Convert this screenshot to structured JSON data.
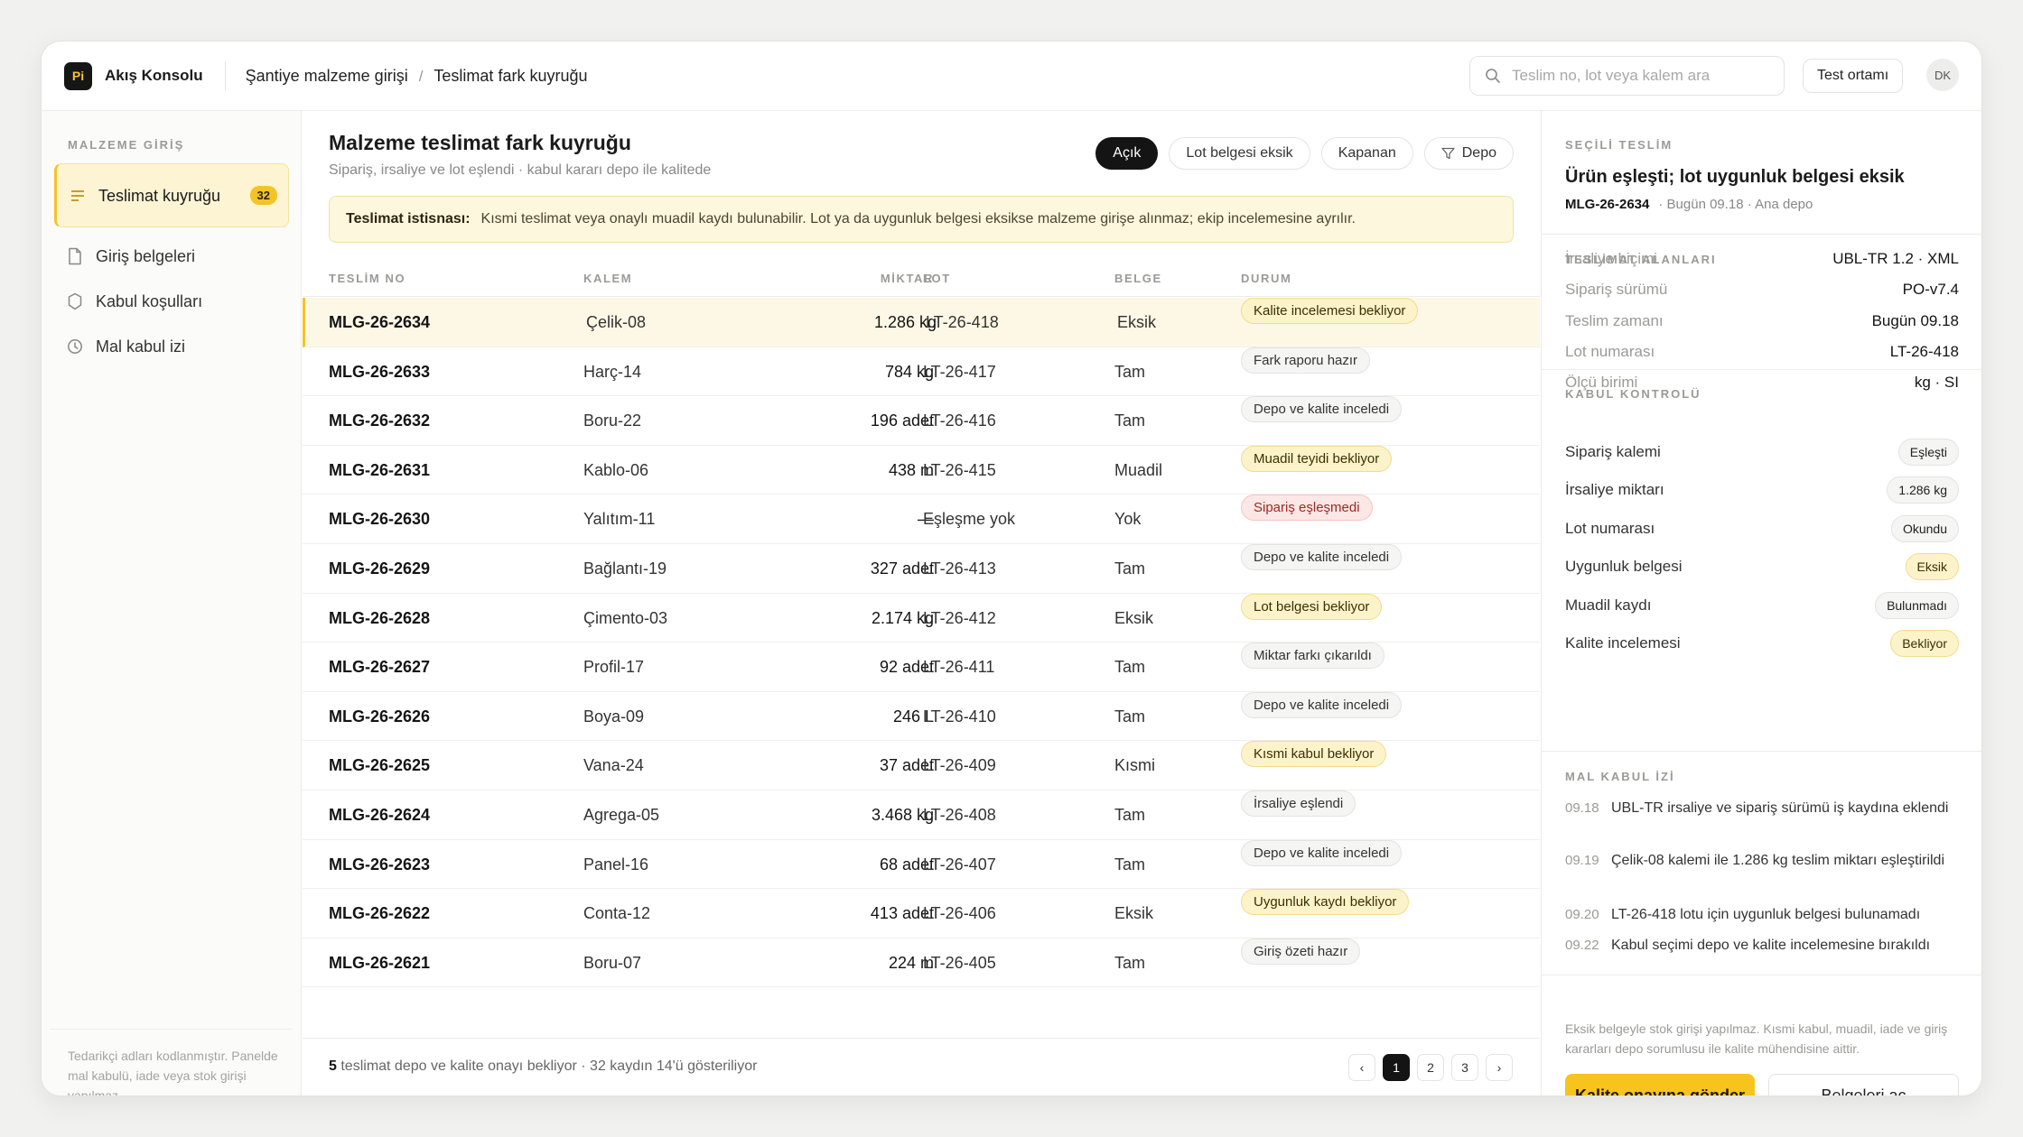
{
  "app": {
    "logo": "Pi",
    "title": "Akış Konsolu"
  },
  "breadcrumb": [
    "Şantiye malzeme girişi",
    "Teslimat fark kuyruğu"
  ],
  "search": {
    "placeholder": "Teslim no, lot veya kalem ara"
  },
  "env_label": "Test ortamı",
  "user_initials": "DK",
  "sidebar": {
    "heading": "MALZEME GİRİŞ",
    "items": [
      {
        "label": "Teslimat kuyruğu",
        "badge": "32",
        "icon": "list-icon",
        "active": true
      },
      {
        "label": "Giriş belgeleri",
        "icon": "document-icon"
      },
      {
        "label": "Kabul koşulları",
        "icon": "shield-icon"
      },
      {
        "label": "Mal kabul izi",
        "icon": "clock-icon"
      }
    ],
    "footer": "Tedarikçi adları kodlanmıştır. Panelde mal kabulü, iade veya stok girişi yapılmaz."
  },
  "main": {
    "title": "Malzeme teslimat fark kuyruğu",
    "subtitle": "Sipariş, irsaliye ve lot eşlendi · kabul kararı depo ile kalitede",
    "filters": [
      "Açık",
      "Lot belgesi eksik",
      "Kapanan",
      "Depo"
    ],
    "notice_label": "Teslimat istisnası:",
    "notice_text": "Kısmi teslimat veya onaylı muadil kaydı bulunabilir. Lot ya da uygunluk belgesi eksikse malzeme girişe alınmaz; ekip incelemesine ayrılır.",
    "columns": [
      "TESLİM NO",
      "KALEM",
      "MİKTAR",
      "LOT",
      "BELGE",
      "DURUM"
    ],
    "rows": [
      {
        "no": "MLG-26-2634",
        "item": "Çelik-08",
        "qty": "1.286 kg",
        "lot": "LT-26-418",
        "doc": "Eksik",
        "status": "Kalite incelemesi bekliyor",
        "tone": "y"
      },
      {
        "no": "MLG-26-2633",
        "item": "Harç-14",
        "qty": "784 kg",
        "lot": "LT-26-417",
        "doc": "Tam",
        "status": "Fark raporu hazır",
        "tone": "g"
      },
      {
        "no": "MLG-26-2632",
        "item": "Boru-22",
        "qty": "196 adet",
        "lot": "LT-26-416",
        "doc": "Tam",
        "status": "Depo ve kalite inceledi",
        "tone": "g"
      },
      {
        "no": "MLG-26-2631",
        "item": "Kablo-06",
        "qty": "438 m",
        "lot": "LT-26-415",
        "doc": "Muadil",
        "status": "Muadil teyidi bekliyor",
        "tone": "y"
      },
      {
        "no": "MLG-26-2630",
        "item": "Yalıtım-11",
        "qty": "—",
        "lot": "Eşleşme yok",
        "doc": "Yok",
        "status": "Sipariş eşleşmedi",
        "tone": "r"
      },
      {
        "no": "MLG-26-2629",
        "item": "Bağlantı-19",
        "qty": "327 adet",
        "lot": "LT-26-413",
        "doc": "Tam",
        "status": "Depo ve kalite inceledi",
        "tone": "g"
      },
      {
        "no": "MLG-26-2628",
        "item": "Çimento-03",
        "qty": "2.174 kg",
        "lot": "LT-26-412",
        "doc": "Eksik",
        "status": "Lot belgesi bekliyor",
        "tone": "y"
      },
      {
        "no": "MLG-26-2627",
        "item": "Profil-17",
        "qty": "92 adet",
        "lot": "LT-26-411",
        "doc": "Tam",
        "status": "Miktar farkı çıkarıldı",
        "tone": "g"
      },
      {
        "no": "MLG-26-2626",
        "item": "Boya-09",
        "qty": "246 L",
        "lot": "LT-26-410",
        "doc": "Tam",
        "status": "Depo ve kalite inceledi",
        "tone": "g"
      },
      {
        "no": "MLG-26-2625",
        "item": "Vana-24",
        "qty": "37 adet",
        "lot": "LT-26-409",
        "doc": "Kısmi",
        "status": "Kısmi kabul bekliyor",
        "tone": "y"
      },
      {
        "no": "MLG-26-2624",
        "item": "Agrega-05",
        "qty": "3.468 kg",
        "lot": "LT-26-408",
        "doc": "Tam",
        "status": "İrsaliye eşlendi",
        "tone": "g"
      },
      {
        "no": "MLG-26-2623",
        "item": "Panel-16",
        "qty": "68 adet",
        "lot": "LT-26-407",
        "doc": "Tam",
        "status": "Depo ve kalite inceledi",
        "tone": "g"
      },
      {
        "no": "MLG-26-2622",
        "item": "Conta-12",
        "qty": "413 adet",
        "lot": "LT-26-406",
        "doc": "Eksik",
        "status": "Uygunluk kaydı bekliyor",
        "tone": "y"
      },
      {
        "no": "MLG-26-2621",
        "item": "Boru-07",
        "qty": "224 m",
        "lot": "LT-26-405",
        "doc": "Tam",
        "status": "Giriş özeti hazır",
        "tone": "g"
      }
    ],
    "footer_count": "5",
    "footer_text": "teslimat depo ve kalite onayı bekliyor · 32 kaydın 14'ü gösteriliyor",
    "pages": [
      "‹",
      "1",
      "2",
      "3",
      "›"
    ]
  },
  "panel": {
    "heading": "SEÇİLİ TESLİM",
    "title": "Ürün eşleşti; lot uygunluk belgesi eksik",
    "id": "MLG-26-2634",
    "meta": "· Bugün 09.18 · Ana depo",
    "fields_heading": "TESLİMAT ALANLARI",
    "fields": [
      {
        "k": "İrsaliye biçimi",
        "v": "UBL-TR 1.2 · XML"
      },
      {
        "k": "Sipariş sürümü",
        "v": "PO-v7.4"
      },
      {
        "k": "Teslim zamanı",
        "v": "Bugün 09.18"
      },
      {
        "k": "Lot numarası",
        "v": "LT-26-418"
      },
      {
        "k": "Ölçü birimi",
        "v": "kg · SI"
      }
    ],
    "checks_heading": "KABUL KONTROLÜ",
    "checks": [
      {
        "k": "Sipariş kalemi",
        "v": "Eşleşti",
        "tone": "g"
      },
      {
        "k": "İrsaliye miktarı",
        "v": "1.286 kg",
        "tone": "g"
      },
      {
        "k": "Lot numarası",
        "v": "Okundu",
        "tone": "g"
      },
      {
        "k": "Uygunluk belgesi",
        "v": "Eksik",
        "tone": "y"
      },
      {
        "k": "Muadil kaydı",
        "v": "Bulunmadı",
        "tone": "g"
      },
      {
        "k": "Kalite incelemesi",
        "v": "Bekliyor",
        "tone": "y"
      }
    ],
    "log_heading": "MAL KABUL İZİ",
    "log": [
      {
        "t": "09.18",
        "d": "UBL-TR irsaliye ve sipariş sürümü iş kaydına eklendi"
      },
      {
        "t": "09.19",
        "d": "Çelik-08 kalemi ile 1.286 kg teslim miktarı eşleştirildi"
      },
      {
        "t": "09.20",
        "d": "LT-26-418 lotu için uygunluk belgesi bulunamadı"
      },
      {
        "t": "09.22",
        "d": "Kabul seçimi depo ve kalite incelemesine bırakıldı"
      }
    ],
    "footer": "Eksik belgeyle stok girişi yapılmaz. Kısmi kabul, muadil, iade ve giriş kararları depo sorumlusu ile kalite mühendisine aittir.",
    "primary_btn": "Kalite onayına gönder",
    "secondary_btn": "Belgeleri aç"
  },
  "colors": {
    "accent": "#f6c41d",
    "dark": "#141414",
    "warn_bg": "#fdf3cb",
    "error_bg": "#fde7e6"
  }
}
